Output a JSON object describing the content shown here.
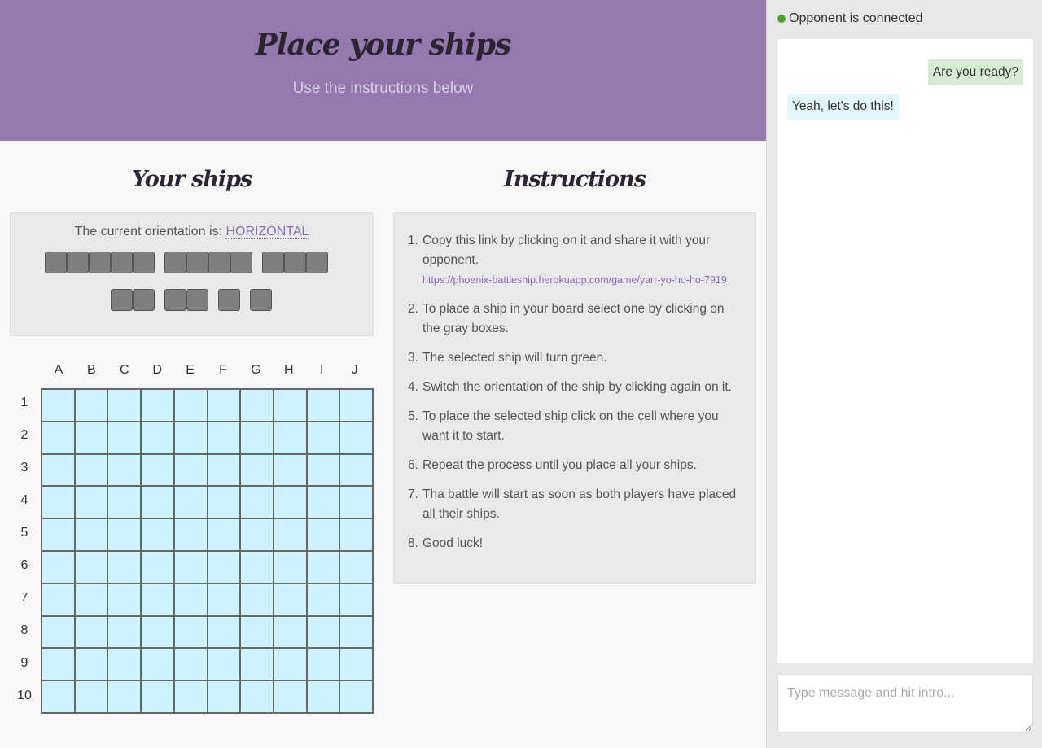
{
  "header": {
    "title": "Place your ships",
    "subtitle": "Use the instructions below"
  },
  "ships_section": {
    "title": "Your ships",
    "orientation_prefix": "The current orientation is:",
    "orientation_value": "HORIZONTAL",
    "ships_sizes": [
      5,
      4,
      3,
      2,
      2,
      1,
      1
    ]
  },
  "board": {
    "columns": [
      "A",
      "B",
      "C",
      "D",
      "E",
      "F",
      "G",
      "H",
      "I",
      "J"
    ],
    "rows": [
      "1",
      "2",
      "3",
      "4",
      "5",
      "6",
      "7",
      "8",
      "9",
      "10"
    ]
  },
  "instructions": {
    "title": "Instructions",
    "steps": [
      {
        "num": "1.",
        "text": "Copy this link by clicking on it and share it with your opponent.",
        "link": "https://phoenix-battleship.herokuapp.com/game/yarr-yo-ho-ho-7919"
      },
      {
        "num": "2.",
        "text": "To place a ship in your board select one by clicking on the gray boxes."
      },
      {
        "num": "3.",
        "text": "The selected ship will turn green."
      },
      {
        "num": "4.",
        "text": "Switch the orientation of the ship by clicking again on it."
      },
      {
        "num": "5.",
        "text": "To place the selected ship click on the cell where you want it to start."
      },
      {
        "num": "6.",
        "text": "Repeat the process until you place all your ships."
      },
      {
        "num": "7.",
        "text": "Tha battle will start as soon as both players have placed all their ships."
      },
      {
        "num": "8.",
        "text": "Good luck!"
      }
    ]
  },
  "chat": {
    "status": "Opponent is connected",
    "status_color": "#4ea42a",
    "messages": [
      {
        "from": "me",
        "text": "Are you ready?"
      },
      {
        "from": "opponent",
        "text": "Yeah, let's do this!"
      }
    ],
    "input_placeholder": "Type message and hit intro..."
  }
}
